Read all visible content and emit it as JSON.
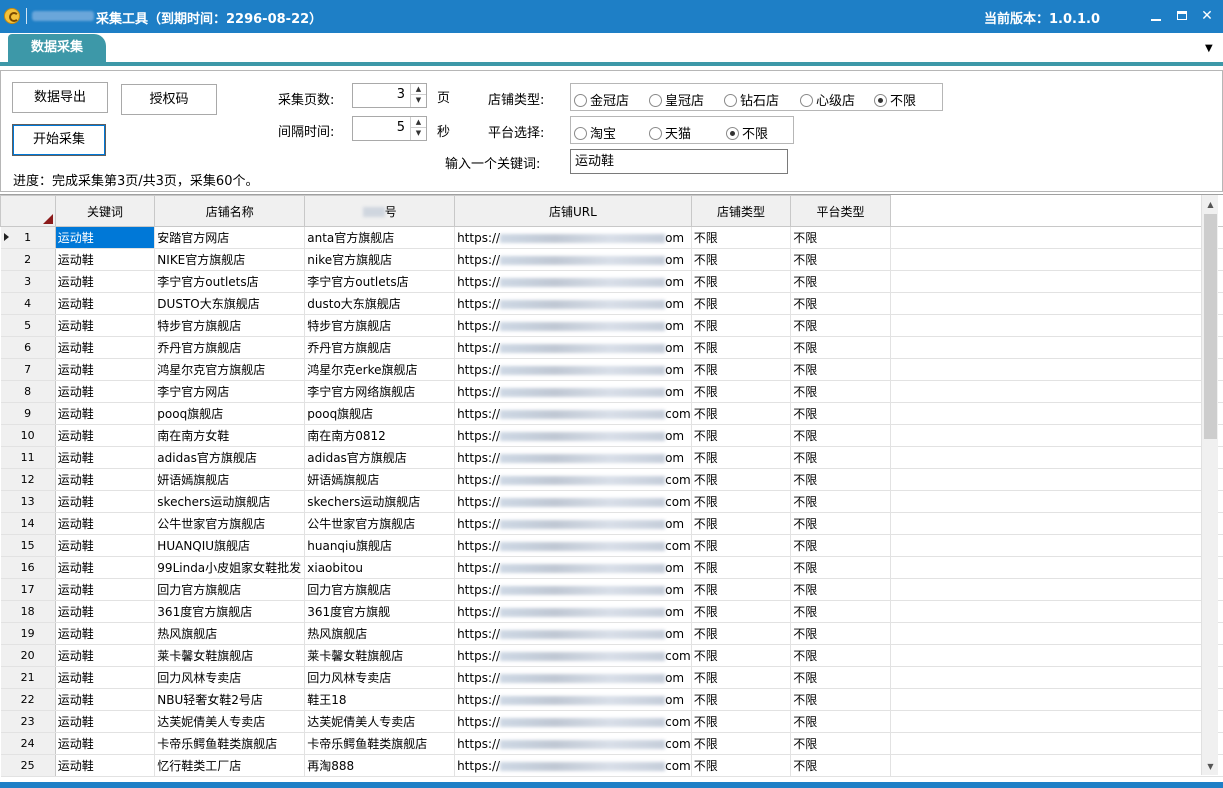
{
  "window": {
    "title": "采集工具（到期时间：2296-08-22）",
    "version": "当前版本：1.0.1.0",
    "controls": {
      "minimize": "",
      "maximize": "",
      "close": "✕"
    }
  },
  "tabs": [
    {
      "label": "数据采集"
    }
  ],
  "tabstrip": {
    "dropdown": "▼"
  },
  "panel": {
    "export_label": "数据导出",
    "auth_label": "授权码",
    "start_label": "开始采集",
    "pages_label": "采集页数:",
    "pages_value": "3",
    "pages_unit": "页",
    "interval_label": "间隔时间:",
    "interval_value": "5",
    "interval_unit": "秒",
    "shop_type_label": "店铺类型:",
    "shop_types": [
      {
        "label": "金冠店",
        "checked": false
      },
      {
        "label": "皇冠店",
        "checked": false
      },
      {
        "label": "钻石店",
        "checked": false
      },
      {
        "label": "心级店",
        "checked": false
      },
      {
        "label": "不限",
        "checked": true
      }
    ],
    "platform_label": "平台选择:",
    "platforms": [
      {
        "label": "淘宝",
        "checked": false
      },
      {
        "label": "天猫",
        "checked": false
      },
      {
        "label": "不限",
        "checked": true
      }
    ],
    "keyword_label": "输入一个关键词:",
    "keyword_value": "运动鞋",
    "progress": "进度：完成采集第3页/共3页，采集60个。"
  },
  "grid": {
    "columns": [
      "关键词",
      "店铺名称",
      "号",
      "店铺URL",
      "店铺类型",
      "平台类型"
    ],
    "url_prefix": "https://",
    "rows": [
      {
        "n": "1",
        "kw": "运动鞋",
        "shop": "安踏官方网店",
        "acct": "anta官方旗舰店",
        "url_end": "om",
        "type": "不限",
        "plat": "不限"
      },
      {
        "n": "2",
        "kw": "运动鞋",
        "shop": "NIKE官方旗舰店",
        "acct": "nike官方旗舰店",
        "url_end": "om",
        "type": "不限",
        "plat": "不限"
      },
      {
        "n": "3",
        "kw": "运动鞋",
        "shop": "李宁官方outlets店",
        "acct": "李宁官方outlets店",
        "url_end": "om",
        "type": "不限",
        "plat": "不限"
      },
      {
        "n": "4",
        "kw": "运动鞋",
        "shop": "DUSTO大东旗舰店",
        "acct": "dusto大东旗舰店",
        "url_end": "om",
        "type": "不限",
        "plat": "不限"
      },
      {
        "n": "5",
        "kw": "运动鞋",
        "shop": "特步官方旗舰店",
        "acct": "特步官方旗舰店",
        "url_end": "om",
        "type": "不限",
        "plat": "不限"
      },
      {
        "n": "6",
        "kw": "运动鞋",
        "shop": "乔丹官方旗舰店",
        "acct": "乔丹官方旗舰店",
        "url_end": "om",
        "type": "不限",
        "plat": "不限"
      },
      {
        "n": "7",
        "kw": "运动鞋",
        "shop": "鸿星尔克官方旗舰店",
        "acct": "鸿星尔克erke旗舰店",
        "url_end": "om",
        "type": "不限",
        "plat": "不限"
      },
      {
        "n": "8",
        "kw": "运动鞋",
        "shop": "李宁官方网店",
        "acct": "李宁官方网络旗舰店",
        "url_end": "om",
        "type": "不限",
        "plat": "不限"
      },
      {
        "n": "9",
        "kw": "运动鞋",
        "shop": "pooq旗舰店",
        "acct": "pooq旗舰店",
        "url_end": "com",
        "type": "不限",
        "plat": "不限"
      },
      {
        "n": "10",
        "kw": "运动鞋",
        "shop": "南在南方女鞋",
        "acct": "南在南方0812",
        "url_end": "om",
        "type": "不限",
        "plat": "不限"
      },
      {
        "n": "11",
        "kw": "运动鞋",
        "shop": "adidas官方旗舰店",
        "acct": "adidas官方旗舰店",
        "url_end": "om",
        "type": "不限",
        "plat": "不限"
      },
      {
        "n": "12",
        "kw": "运动鞋",
        "shop": "妍语嫣旗舰店",
        "acct": "妍语嫣旗舰店",
        "url_end": "com",
        "type": "不限",
        "plat": "不限"
      },
      {
        "n": "13",
        "kw": "运动鞋",
        "shop": "skechers运动旗舰店",
        "acct": "skechers运动旗舰店",
        "url_end": "com",
        "type": "不限",
        "plat": "不限"
      },
      {
        "n": "14",
        "kw": "运动鞋",
        "shop": "公牛世家官方旗舰店",
        "acct": "公牛世家官方旗舰店",
        "url_end": "om",
        "type": "不限",
        "plat": "不限"
      },
      {
        "n": "15",
        "kw": "运动鞋",
        "shop": "HUANQIU旗舰店",
        "acct": "huanqiu旗舰店",
        "url_end": "com",
        "type": "不限",
        "plat": "不限"
      },
      {
        "n": "16",
        "kw": "运动鞋",
        "shop": "99Linda小皮姐家女鞋批发",
        "acct": "xiaobitou",
        "url_end": "om",
        "type": "不限",
        "plat": "不限"
      },
      {
        "n": "17",
        "kw": "运动鞋",
        "shop": "回力官方旗舰店",
        "acct": "回力官方旗舰店",
        "url_end": "om",
        "type": "不限",
        "plat": "不限"
      },
      {
        "n": "18",
        "kw": "运动鞋",
        "shop": "361度官方旗舰店",
        "acct": "361度官方旗舰",
        "url_end": "om",
        "type": "不限",
        "plat": "不限"
      },
      {
        "n": "19",
        "kw": "运动鞋",
        "shop": "热风旗舰店",
        "acct": "热风旗舰店",
        "url_end": "om",
        "type": "不限",
        "plat": "不限"
      },
      {
        "n": "20",
        "kw": "运动鞋",
        "shop": "莱卡馨女鞋旗舰店",
        "acct": "莱卡馨女鞋旗舰店",
        "url_end": "com",
        "type": "不限",
        "plat": "不限"
      },
      {
        "n": "21",
        "kw": "运动鞋",
        "shop": "回力风林专卖店",
        "acct": "回力风林专卖店",
        "url_end": "om",
        "type": "不限",
        "plat": "不限"
      },
      {
        "n": "22",
        "kw": "运动鞋",
        "shop": "NBU轻奢女鞋2号店",
        "acct": "鞋王18",
        "url_end": "om",
        "type": "不限",
        "plat": "不限"
      },
      {
        "n": "23",
        "kw": "运动鞋",
        "shop": "达芙妮倩美人专卖店",
        "acct": "达芙妮倩美人专卖店",
        "url_end": "com",
        "type": "不限",
        "plat": "不限"
      },
      {
        "n": "24",
        "kw": "运动鞋",
        "shop": "卡帝乐鳄鱼鞋类旗舰店",
        "acct": "卡帝乐鳄鱼鞋类旗舰店",
        "url_end": "com",
        "type": "不限",
        "plat": "不限"
      },
      {
        "n": "25",
        "kw": "运动鞋",
        "shop": "忆行鞋类工厂店",
        "acct": "再淘888",
        "url_end": "com",
        "type": "不限",
        "plat": "不限"
      }
    ]
  },
  "scrollbar": {
    "up": "▲",
    "down": "▼"
  },
  "colors": {
    "titlebar": "#1e7fc6",
    "tab": "#3d98a8",
    "selection": "#0078d7"
  }
}
